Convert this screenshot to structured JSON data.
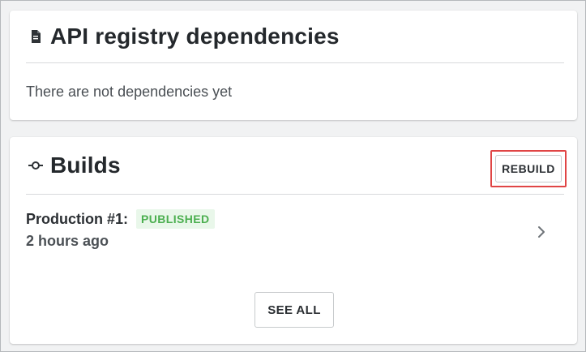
{
  "dependencies_card": {
    "title": "API registry dependencies",
    "empty_message": "There are not dependencies yet",
    "icon": "document-icon"
  },
  "builds_card": {
    "title": "Builds",
    "icon": "commit-icon",
    "rebuild_label": "REBUILD",
    "items": [
      {
        "name": "Production #1:",
        "status": "PUBLISHED",
        "time": "2 hours ago"
      }
    ],
    "see_all_label": "SEE ALL"
  },
  "colors": {
    "highlight": "#e04545",
    "published_text": "#4caf50",
    "published_bg": "#e9f7ea"
  }
}
